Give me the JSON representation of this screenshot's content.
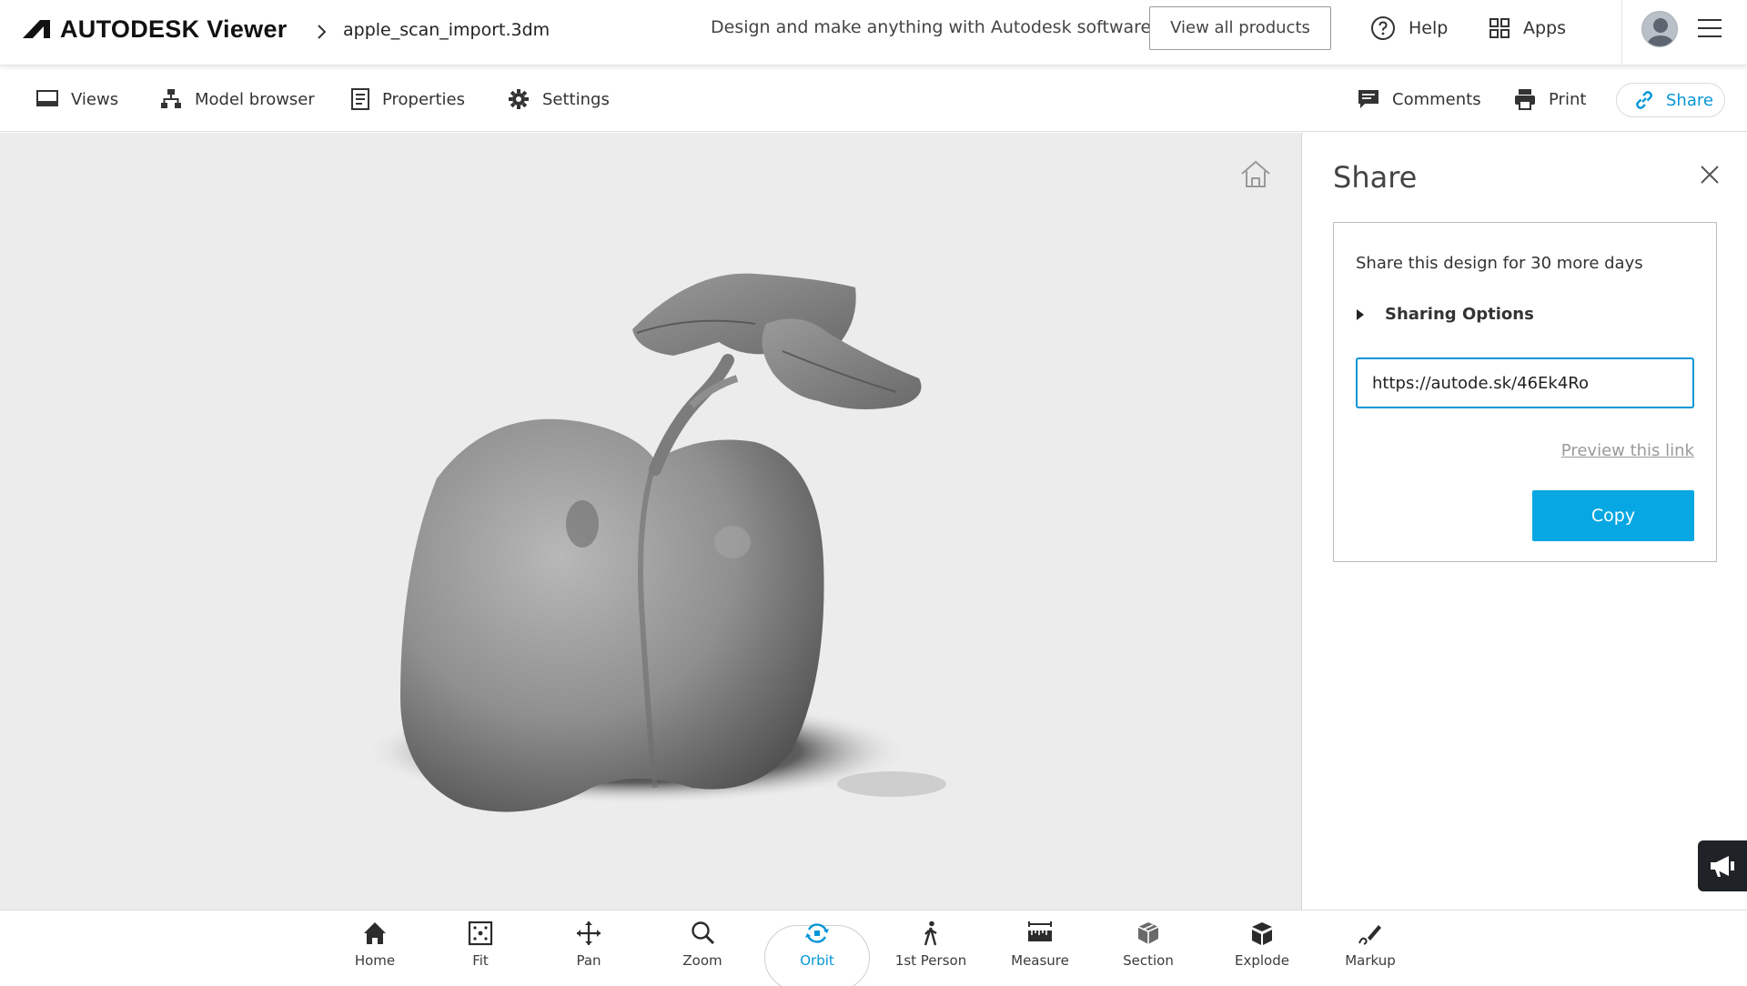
{
  "header": {
    "brand": "AUTODESK Viewer",
    "file_name": "apple_scan_import.3dm",
    "tagline": "Design and make anything with Autodesk software",
    "view_all_label": "View all products",
    "help_label": "Help",
    "apps_label": "Apps"
  },
  "toolbar": {
    "views_label": "Views",
    "model_browser_label": "Model browser",
    "properties_label": "Properties",
    "settings_label": "Settings",
    "comments_label": "Comments",
    "print_label": "Print",
    "share_label": "Share"
  },
  "share_panel": {
    "title": "Share",
    "days_text": "Share this design for 30 more days",
    "sharing_options_label": "Sharing Options",
    "link_value": "https://autode.sk/46Ek4Ro",
    "preview_label": "Preview this link",
    "copy_label": "Copy"
  },
  "bottom_tools": [
    {
      "label": "Home",
      "icon": "home-icon"
    },
    {
      "label": "Fit",
      "icon": "fit-icon"
    },
    {
      "label": "Pan",
      "icon": "pan-icon"
    },
    {
      "label": "Zoom",
      "icon": "zoom-icon"
    },
    {
      "label": "Orbit",
      "icon": "orbit-icon",
      "active": true
    },
    {
      "label": "1st Person",
      "icon": "first-person-icon"
    },
    {
      "label": "Measure",
      "icon": "measure-icon"
    },
    {
      "label": "Section",
      "icon": "section-icon"
    },
    {
      "label": "Explode",
      "icon": "explode-icon"
    },
    {
      "label": "Markup",
      "icon": "markup-icon"
    }
  ],
  "colors": {
    "accent": "#0696d7",
    "copy_button": "#06a7e2",
    "canvas_bg": "#ececec"
  }
}
